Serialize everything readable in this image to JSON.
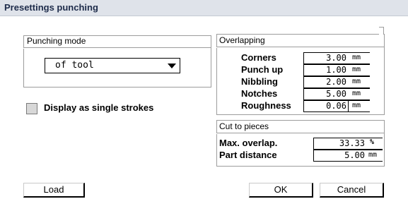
{
  "title": "Presettings punching",
  "punching_mode": {
    "label": "Punching mode",
    "selected": "of tool"
  },
  "display_single_strokes": {
    "label": "Display as single strokes",
    "checked": false
  },
  "overlapping": {
    "label": "Overlapping",
    "rows": [
      {
        "label": "Corners",
        "value": "3.00",
        "unit": "mm"
      },
      {
        "label": "Punch up",
        "value": "1.00",
        "unit": "mm"
      },
      {
        "label": "Nibbling",
        "value": "2.00",
        "unit": "mm"
      },
      {
        "label": "Notches",
        "value": "5.00",
        "unit": "mm"
      },
      {
        "label": "Roughness",
        "value": "0.06",
        "unit": "mm"
      }
    ]
  },
  "cut_to_pieces": {
    "label": "Cut to pieces",
    "rows": [
      {
        "label": "Max. overlap.",
        "value": "33.33",
        "unit": "%"
      },
      {
        "label": "Part distance",
        "value": "5.00",
        "unit": "mm"
      }
    ]
  },
  "buttons": {
    "load": "Load",
    "ok": "OK",
    "cancel": "Cancel"
  }
}
